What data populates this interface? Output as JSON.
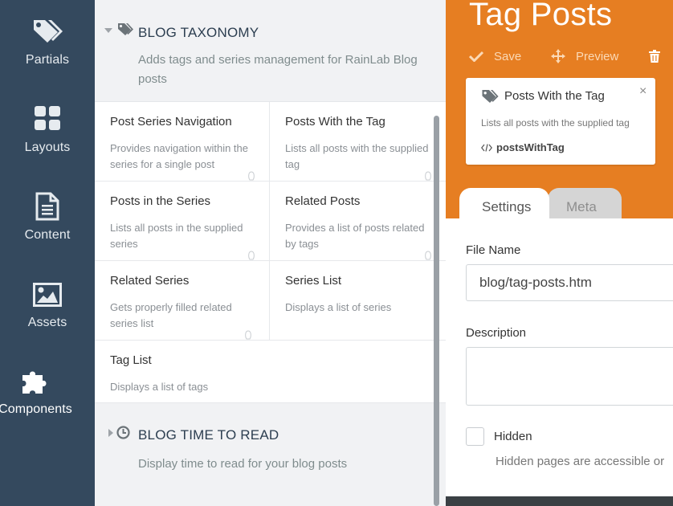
{
  "sidebar": {
    "items": [
      {
        "label": "Partials",
        "icon": "tags-icon"
      },
      {
        "label": "Layouts",
        "icon": "layout-grid-icon"
      },
      {
        "label": "Content",
        "icon": "document-icon"
      },
      {
        "label": "Assets",
        "icon": "image-icon"
      },
      {
        "label": "Components",
        "icon": "puzzle-icon",
        "active": true
      }
    ]
  },
  "components": {
    "groups": [
      {
        "title": "BLOG TAXONOMY",
        "description": "Adds tags and series management for RainLab Blog posts",
        "expanded": true,
        "items": [
          {
            "title": "Post Series Navigation",
            "description": "Provides navigation within the series for a single post"
          },
          {
            "title": "Posts With the Tag",
            "description": "Lists all posts with the supplied tag"
          },
          {
            "title": "Posts in the Series",
            "description": "Lists all posts in the supplied series"
          },
          {
            "title": "Related Posts",
            "description": "Provides a list of posts related by tags"
          },
          {
            "title": "Related Series",
            "description": "Gets properly filled related series list"
          },
          {
            "title": "Series List",
            "description": "Displays a list of series"
          },
          {
            "title": "Tag List",
            "description": "Displays a list of tags"
          }
        ]
      },
      {
        "title": "BLOG TIME TO READ",
        "description": "Display time to read for your blog posts",
        "expanded": false
      }
    ]
  },
  "editor": {
    "title": "Tag Posts",
    "toolbar": {
      "save_label": "Save",
      "preview_label": "Preview"
    },
    "component_popup": {
      "title": "Posts With the Tag",
      "description": "Lists all posts with the supplied tag",
      "code": "postsWithTag",
      "close": "×"
    },
    "tabs": [
      {
        "label": "Settings",
        "active": true
      },
      {
        "label": "Meta",
        "active": false
      }
    ],
    "fields": {
      "file_name_label": "File Name",
      "file_name_value": "blog/tag-posts.htm",
      "description_label": "Description",
      "description_value": "",
      "hidden_label": "Hidden",
      "hidden_checked": false,
      "hidden_hint": "Hidden pages are accessible or"
    }
  },
  "colors": {
    "sidebar": "#34495e",
    "accent": "#e67e22",
    "list_background": "#f1f2f4"
  }
}
